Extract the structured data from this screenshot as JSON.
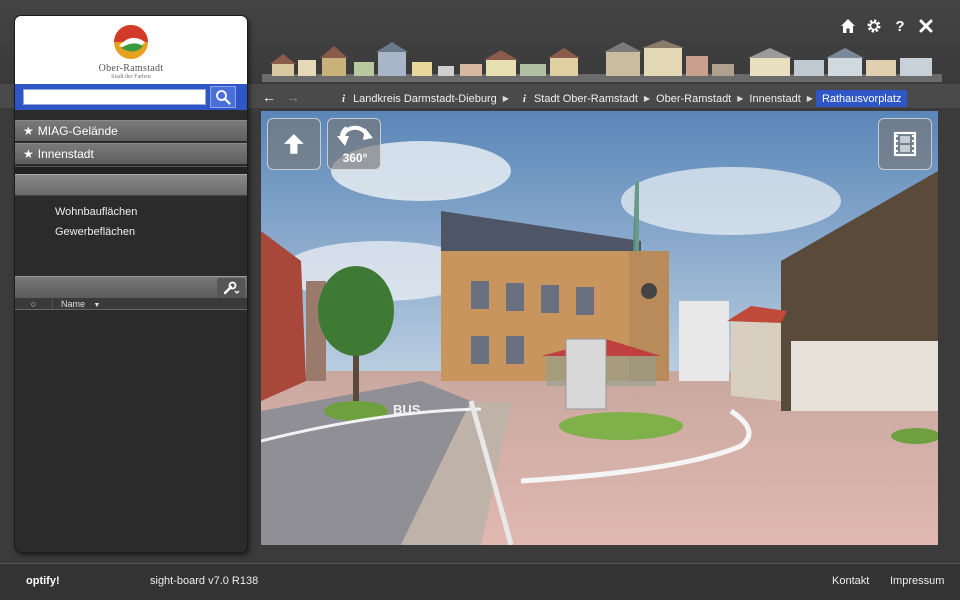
{
  "header": {
    "icons": [
      "home-icon",
      "gear-icon",
      "help-icon",
      "close-icon"
    ],
    "help_label": "?"
  },
  "logo": {
    "name": "Ober-Ramstadt",
    "tagline": "Stadt der Farben"
  },
  "search": {
    "placeholder": "",
    "value": ""
  },
  "favorites": [
    {
      "label": "MIAG-Gelände"
    },
    {
      "label": "Innenstadt"
    }
  ],
  "layers": [
    {
      "label": "Wohnbauflächen"
    },
    {
      "label": "Gewerbeflächen"
    }
  ],
  "table": {
    "col0": "○",
    "col1": "Name"
  },
  "breadcrumb": [
    {
      "label": "Landkreis Darmstadt-Dieburg",
      "info": true
    },
    {
      "label": "Stadt Ober-Ramstadt",
      "info": true
    },
    {
      "label": "Ober-Ramstadt",
      "info": false
    },
    {
      "label": "Innenstadt",
      "info": false
    },
    {
      "label": "Rathausvorplatz",
      "info": false,
      "active": true
    }
  ],
  "viewer": {
    "rotate_label": "360°"
  },
  "footer": {
    "brand": "optify!",
    "version": "sight-board v7.0 R138",
    "links": [
      "Kontakt",
      "Impressum"
    ]
  },
  "colors": {
    "accent": "#2f56c6",
    "background": "#3b3b3b"
  }
}
